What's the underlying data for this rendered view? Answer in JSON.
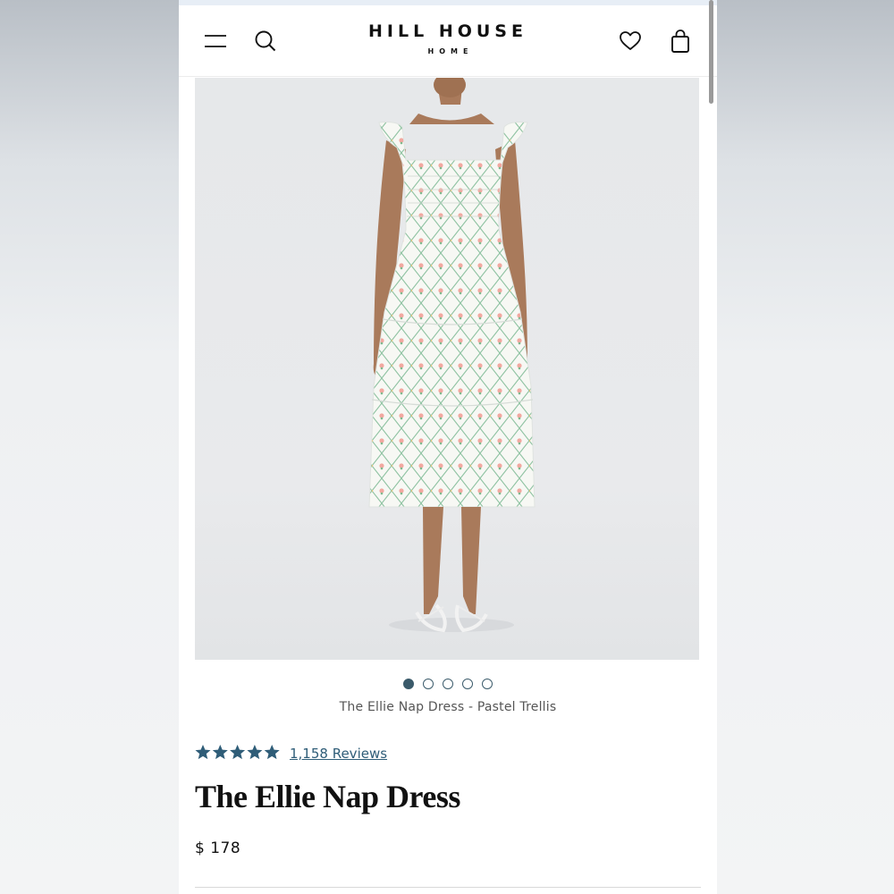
{
  "header": {
    "logo_main": "HILL HOUSE",
    "logo_sub": "HOME",
    "icons": [
      "menu-icon",
      "search-icon",
      "heart-icon",
      "bag-icon"
    ]
  },
  "gallery": {
    "image_alt": "Model wearing The Ellie Nap Dress in Pastel Trellis print",
    "image_count": 5,
    "active_index": 0,
    "caption": "The Ellie Nap Dress - Pastel Trellis"
  },
  "product": {
    "rating": 5,
    "reviews_label": "1,158 Reviews",
    "name": "The Ellie Nap Dress",
    "price": "$ 178"
  },
  "colors": {
    "accent": "#2f5d78",
    "star": "#2f5d78",
    "dot": "#3a5a6a"
  }
}
